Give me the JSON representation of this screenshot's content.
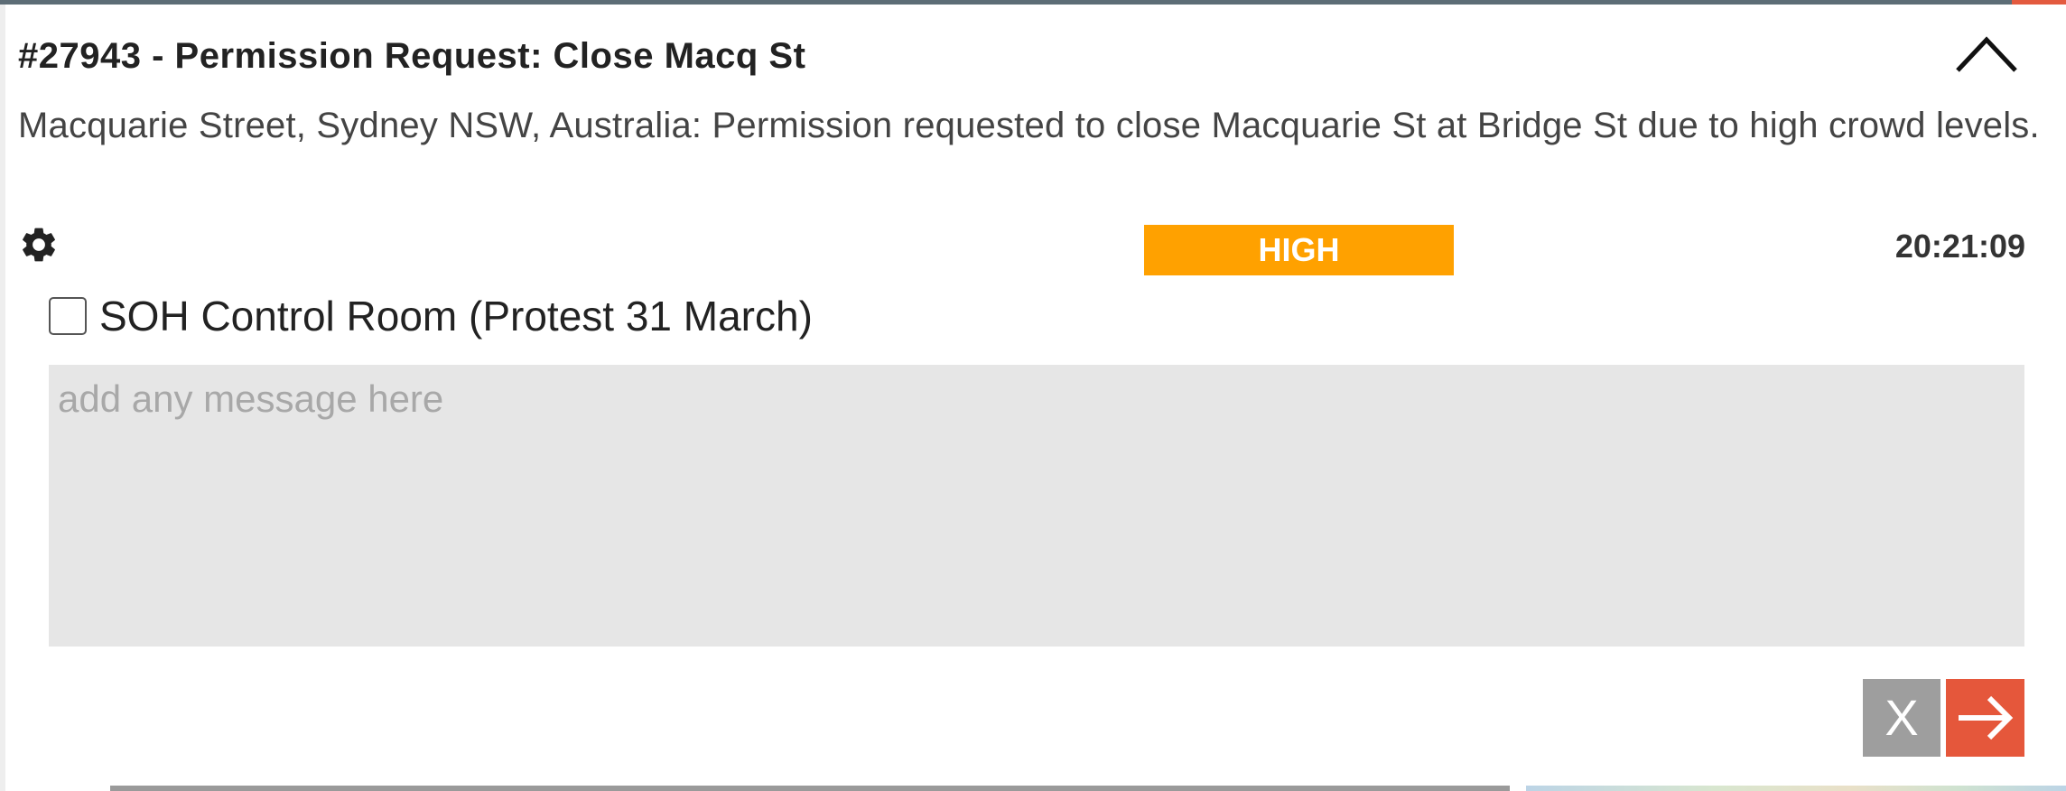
{
  "alert": {
    "title": "#27943 - Permission Request: Close Macq St",
    "description": "Macquarie Street, Sydney NSW, Australia: Permission requested to close Macquarie St at Bridge St due to high crowd levels.",
    "priority": "HIGH",
    "time": "20:21:09"
  },
  "recipient": {
    "label": "SOH Control Room (Protest 31 March)",
    "checked": false
  },
  "message": {
    "placeholder": "add any message here",
    "value": ""
  },
  "actions": {
    "cancel_label": "X"
  },
  "icons": {
    "collapse": "chevron-up-icon",
    "settings": "gear-icon",
    "send": "arrow-right-icon"
  },
  "colors": {
    "priority_high": "#ffa100",
    "send_button": "#e5573b",
    "cancel_button": "#9e9e9e",
    "message_bg": "#e6e6e6"
  }
}
